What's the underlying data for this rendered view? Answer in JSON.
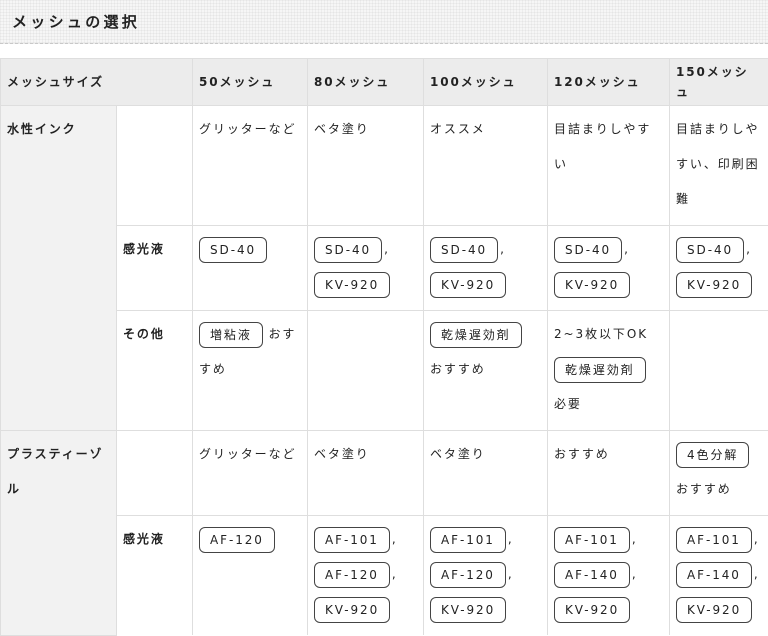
{
  "title": "メッシュの選択",
  "header": {
    "mesh_size": "メッシュサイズ",
    "cols": [
      "50メッシュ",
      "80メッシュ",
      "100メッシュ",
      "120メッシュ",
      "150メッシュ"
    ]
  },
  "rows": {
    "water": {
      "label": "水性インク",
      "main": [
        "グリッターなど",
        "ベタ塗り",
        "オススメ",
        "目詰まりしやすい",
        "目詰まりしやすい、印刷困難"
      ],
      "emulsion_label": "感光液",
      "emulsion": {
        "c1": [
          "SD-40"
        ],
        "c2": [
          "SD-40",
          "KV-920"
        ],
        "c3": [
          "SD-40",
          "KV-920"
        ],
        "c4": [
          "SD-40",
          "KV-920"
        ],
        "c5": [
          "SD-40",
          "KV-920"
        ]
      },
      "other_label": "その他",
      "other": {
        "c1_tag": "増粘液",
        "c1_text": "おすすめ",
        "c3_tag": "乾燥遅効剤",
        "c3_text": "おすすめ",
        "c4_pre": "2~3枚以下OK",
        "c4_tag": "乾燥遅効剤",
        "c4_text": "必要"
      }
    },
    "plastisol": {
      "label": "プラスティーゾル",
      "main": [
        "グリッターなど",
        "ベタ塗り",
        "ベタ塗り",
        "おすすめ"
      ],
      "c5_tag": "4色分解",
      "c5_text": "おすすめ",
      "emulsion_label": "感光液",
      "emulsion": {
        "c1": [
          "AF-120"
        ],
        "c2": [
          "AF-101",
          "AF-120",
          "KV-920"
        ],
        "c3": [
          "AF-101",
          "AF-120",
          "KV-920"
        ],
        "c4": [
          "AF-101",
          "AF-140",
          "KV-920"
        ],
        "c5": [
          "AF-101",
          "AF-140",
          "KV-920"
        ]
      }
    }
  },
  "separator": ","
}
